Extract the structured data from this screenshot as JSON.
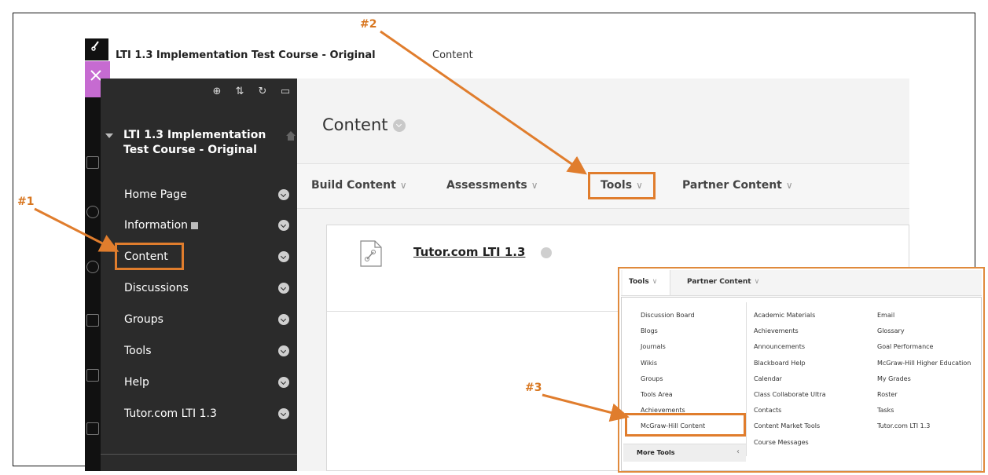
{
  "topbar": {
    "course_title": "LTI 1.3 Implementation Test Course - Original",
    "breadcrumb": "Content"
  },
  "sidebar": {
    "course_title": "LTI 1.3 Implementation Test Course - Original",
    "items": [
      {
        "label": "Home Page"
      },
      {
        "label": "Information"
      },
      {
        "label": "Content"
      },
      {
        "label": "Discussions"
      },
      {
        "label": "Groups"
      },
      {
        "label": "Tools"
      },
      {
        "label": "Help"
      },
      {
        "label": "Tutor.com LTI 1.3"
      }
    ]
  },
  "main": {
    "page_title": "Content",
    "action_bar": [
      "Build Content",
      "Assessments",
      "Tools",
      "Partner Content"
    ],
    "content_item": {
      "title": "Tutor.com LTI 1.3"
    }
  },
  "tools_menu": {
    "tabs": [
      "Tools",
      "Partner Content"
    ],
    "col1": [
      "Discussion Board",
      "Blogs",
      "Journals",
      "Wikis",
      "Groups",
      "Tools Area",
      "Achievements",
      "McGraw-Hill Content"
    ],
    "col2": [
      "Academic Materials",
      "Achievements",
      "Announcements",
      "Blackboard Help",
      "Calendar",
      "Class Collaborate Ultra",
      "Contacts",
      "Content Market Tools",
      "Course Messages"
    ],
    "col3": [
      "Email",
      "Glossary",
      "Goal Performance",
      "McGraw-Hill Higher Education",
      "My Grades",
      "Roster",
      "Tasks",
      "Tutor.com LTI 1.3"
    ],
    "more_tools": "More Tools"
  },
  "callouts": {
    "c1": "#1",
    "c2": "#2",
    "c3": "#3"
  },
  "colors": {
    "accent": "#e07d2d",
    "sidebar_bg": "#2b2b2b",
    "close_tab": "#c66bd1"
  },
  "icons": [
    "link-icon",
    "close-icon",
    "add-icon",
    "sort-icon",
    "refresh-icon",
    "folder-icon",
    "home-icon",
    "file-link-icon"
  ]
}
